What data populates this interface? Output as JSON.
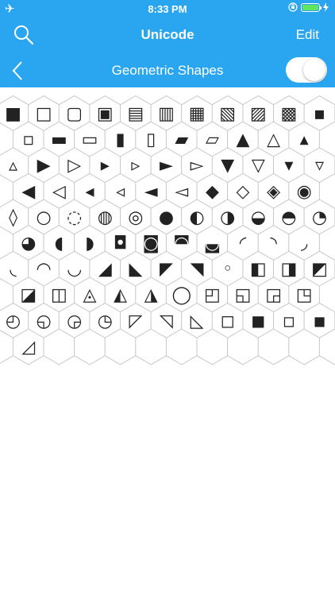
{
  "status": {
    "time": "8:33 PM"
  },
  "nav": {
    "title": "Unicode",
    "edit_label": "Edit",
    "category": "Geometric Shapes",
    "toggle_on": true
  },
  "colors": {
    "header": "#2aa6f0",
    "glyph": "#222222",
    "grid_line": "#c8c8c8"
  },
  "grid": {
    "rows": [
      [
        "■",
        "□",
        "▢",
        "▣",
        "▤",
        "▥",
        "▦",
        "▧",
        "▨",
        "▩",
        "▪"
      ],
      [
        "▫",
        "▬",
        "▭",
        "▮",
        "▯",
        "▰",
        "▱",
        "▲",
        "△",
        "▴"
      ],
      [
        "▵",
        "▶",
        "▷",
        "▸",
        "▹",
        "►",
        "▻",
        "▼",
        "▽",
        "▾",
        "▿"
      ],
      [
        "◀",
        "◁",
        "◂",
        "◃",
        "◄",
        "◅",
        "◆",
        "◇",
        "◈",
        "◉"
      ],
      [
        "◊",
        "○",
        "◌",
        "◍",
        "◎",
        "●",
        "◐",
        "◑",
        "◒",
        "◓",
        "◔"
      ],
      [
        "◕",
        "◖",
        "◗",
        "◘",
        "◙",
        "◚",
        "◛",
        "◜",
        "◝",
        "◞"
      ],
      [
        "◟",
        "◠",
        "◡",
        "◢",
        "◣",
        "◤",
        "◥",
        "◦",
        "◧",
        "◨",
        "◩"
      ],
      [
        "◪",
        "◫",
        "◬",
        "◭",
        "◮",
        "◯",
        "◰",
        "◱",
        "◲",
        "◳"
      ],
      [
        "◴",
        "◵",
        "◶",
        "◷",
        "◸",
        "◹",
        "◺",
        "◻",
        "◼",
        "◽",
        "◾"
      ],
      [
        "◿",
        "",
        "",
        "",
        "",
        "",
        "",
        "",
        "",
        ""
      ]
    ]
  }
}
